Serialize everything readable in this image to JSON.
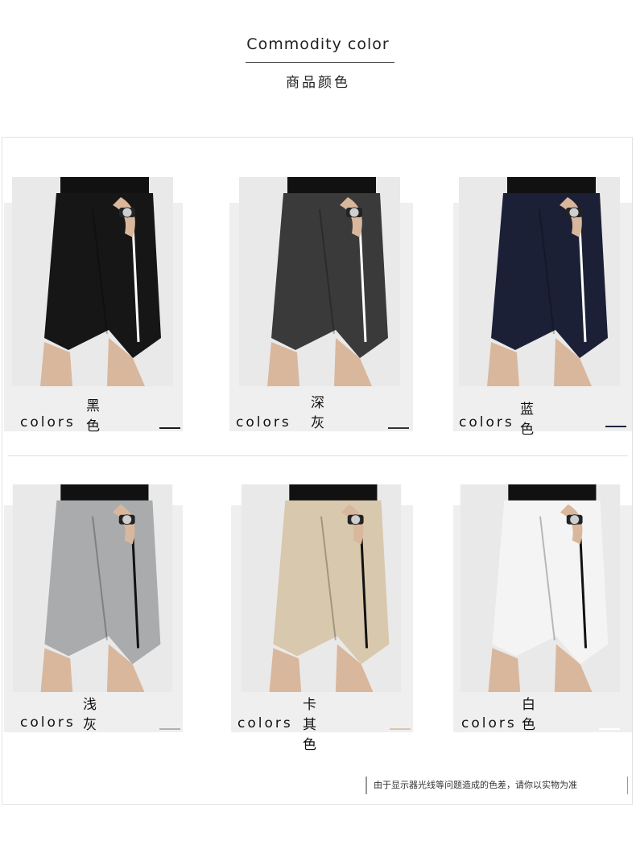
{
  "header": {
    "title": "Commodity color",
    "subtitle": "商品颜色"
  },
  "colors_label": "colors",
  "products": [
    {
      "name": "黑色",
      "fabric": "#161616",
      "stripe": "#ffffff",
      "swatch": "#1a1a1a"
    },
    {
      "name": "深灰",
      "fabric": "#3a3a3a",
      "stripe": "#ffffff",
      "swatch": "#333333"
    },
    {
      "name": "蓝色",
      "fabric": "#1b2036",
      "stripe": "#ffffff",
      "swatch": "#1e2340"
    },
    {
      "name": "浅灰",
      "fabric": "#a9abad",
      "stripe": "#111111",
      "swatch": "#b0b0b0"
    },
    {
      "name": "卡其色",
      "fabric": "#d8c8ad",
      "stripe": "#111111",
      "swatch": "#d6c7b0"
    },
    {
      "name": "白色",
      "fabric": "#f4f4f4",
      "stripe": "#111111",
      "swatch": "#ffffff"
    }
  ],
  "disclaimer": "由于显示器光线等问题造成的色差，请你以实物为准"
}
